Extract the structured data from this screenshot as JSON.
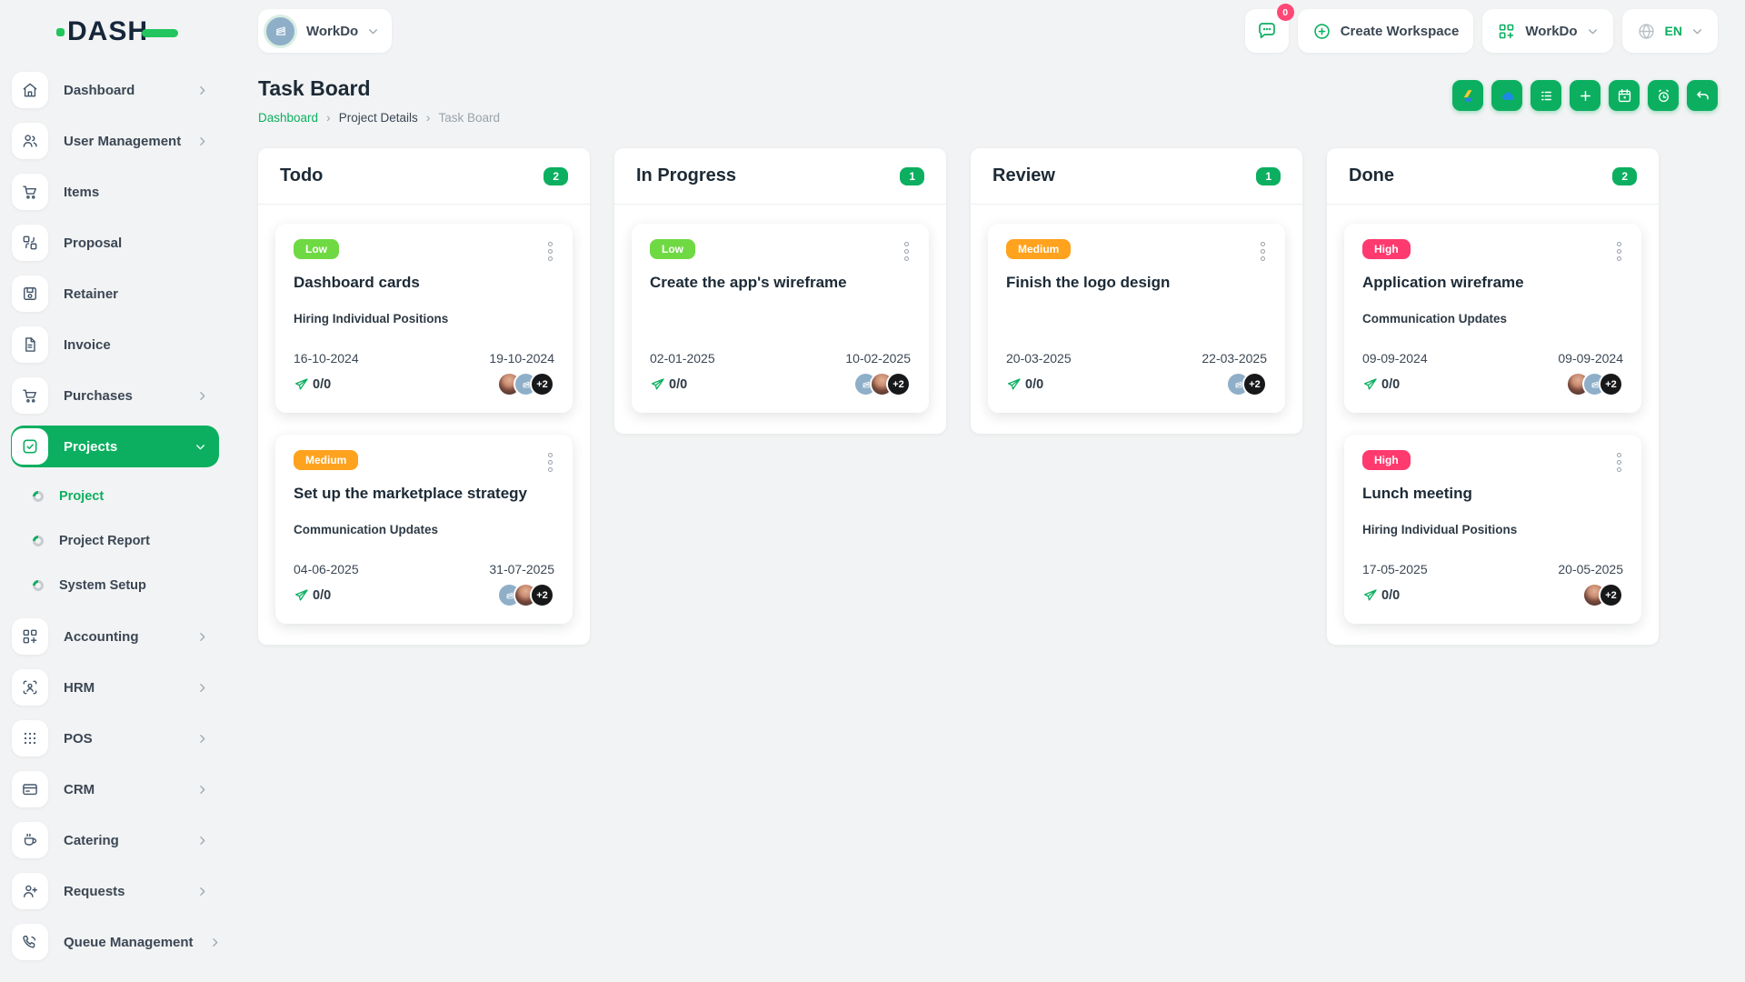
{
  "brand": {
    "name": "DASH"
  },
  "header": {
    "workspace": {
      "label": "WorkDo",
      "icon": "building-avatar-icon"
    },
    "messages_count": "0",
    "create_workspace_label": "Create Workspace",
    "apps_label": "WorkDo",
    "language_code": "EN",
    "icons": [
      "chat-bubble-icon",
      "plus-circle-icon",
      "grid-plus-icon",
      "globe-icon",
      "chevron-down-icon"
    ]
  },
  "sidebar": {
    "items": [
      {
        "label": "Dashboard",
        "icon": "home-icon"
      },
      {
        "label": "User Management",
        "icon": "users-icon"
      },
      {
        "label": "Items",
        "icon": "cart-icon"
      },
      {
        "label": "Proposal",
        "icon": "transfer-icon"
      },
      {
        "label": "Retainer",
        "icon": "save-icon"
      },
      {
        "label": "Invoice",
        "icon": "file-invoice-icon"
      },
      {
        "label": "Purchases",
        "icon": "cart-icon"
      },
      {
        "label": "Projects",
        "icon": "check-square-icon"
      },
      {
        "label": "Accounting",
        "icon": "grid-plus-icon"
      },
      {
        "label": "HRM",
        "icon": "user-scan-icon"
      },
      {
        "label": "POS",
        "icon": "dots-grid-icon"
      },
      {
        "label": "CRM",
        "icon": "card-icon"
      },
      {
        "label": "Catering",
        "icon": "coffee-icon"
      },
      {
        "label": "Requests",
        "icon": "user-plus-icon"
      },
      {
        "label": "Queue Management",
        "icon": "phone-icon"
      }
    ],
    "projects_subitems": [
      {
        "label": "Project"
      },
      {
        "label": "Project Report"
      },
      {
        "label": "System Setup"
      }
    ]
  },
  "page": {
    "title": "Task Board",
    "breadcrumb": {
      "home": "Dashboard",
      "section": "Project Details",
      "current": "Task Board",
      "separator": "›"
    }
  },
  "toolbar": {
    "buttons": [
      "google-drive-icon",
      "onedrive-icon",
      "list-icon",
      "plus-icon",
      "calendar-icon",
      "alarm-icon",
      "undo-icon"
    ]
  },
  "board": {
    "columns": [
      {
        "title": "Todo",
        "count": "2",
        "cards": [
          {
            "priority": "Low",
            "title": "Dashboard cards",
            "milestone": "Hiring Individual Positions",
            "start_date": "16-10-2024",
            "due_date": "19-10-2024",
            "progress": "0/0",
            "extra_members": "+2"
          },
          {
            "priority": "Medium",
            "title": "Set up the marketplace strategy",
            "milestone": "Communication Updates",
            "start_date": "04-06-2025",
            "due_date": "31-07-2025",
            "progress": "0/0",
            "extra_members": "+2"
          }
        ]
      },
      {
        "title": "In Progress",
        "count": "1",
        "cards": [
          {
            "priority": "Low",
            "title": "Create the app's wireframe",
            "milestone": "",
            "start_date": "02-01-2025",
            "due_date": "10-02-2025",
            "progress": "0/0",
            "extra_members": "+2"
          }
        ]
      },
      {
        "title": "Review",
        "count": "1",
        "cards": [
          {
            "priority": "Medium",
            "title": "Finish the logo design",
            "milestone": "",
            "start_date": "20-03-2025",
            "due_date": "22-03-2025",
            "progress": "0/0",
            "extra_members": "+2"
          }
        ]
      },
      {
        "title": "Done",
        "count": "2",
        "cards": [
          {
            "priority": "High",
            "title": "Application wireframe",
            "milestone": "Communication Updates",
            "start_date": "09-09-2024",
            "due_date": "09-09-2024",
            "progress": "0/0",
            "extra_members": "+2"
          },
          {
            "priority": "High",
            "title": "Lunch meeting",
            "milestone": "Hiring Individual Positions",
            "start_date": "17-05-2025",
            "due_date": "20-05-2025",
            "progress": "0/0",
            "extra_members": "+2"
          }
        ]
      }
    ]
  },
  "colors": {
    "primary": "#0caf60",
    "priority_low": "#6fd943",
    "priority_medium": "#ffa21d",
    "priority_high": "#ff3a6e",
    "notification_badge": "#ff4775",
    "brand_navy": "#15263a",
    "brand_green": "#22c55e"
  }
}
